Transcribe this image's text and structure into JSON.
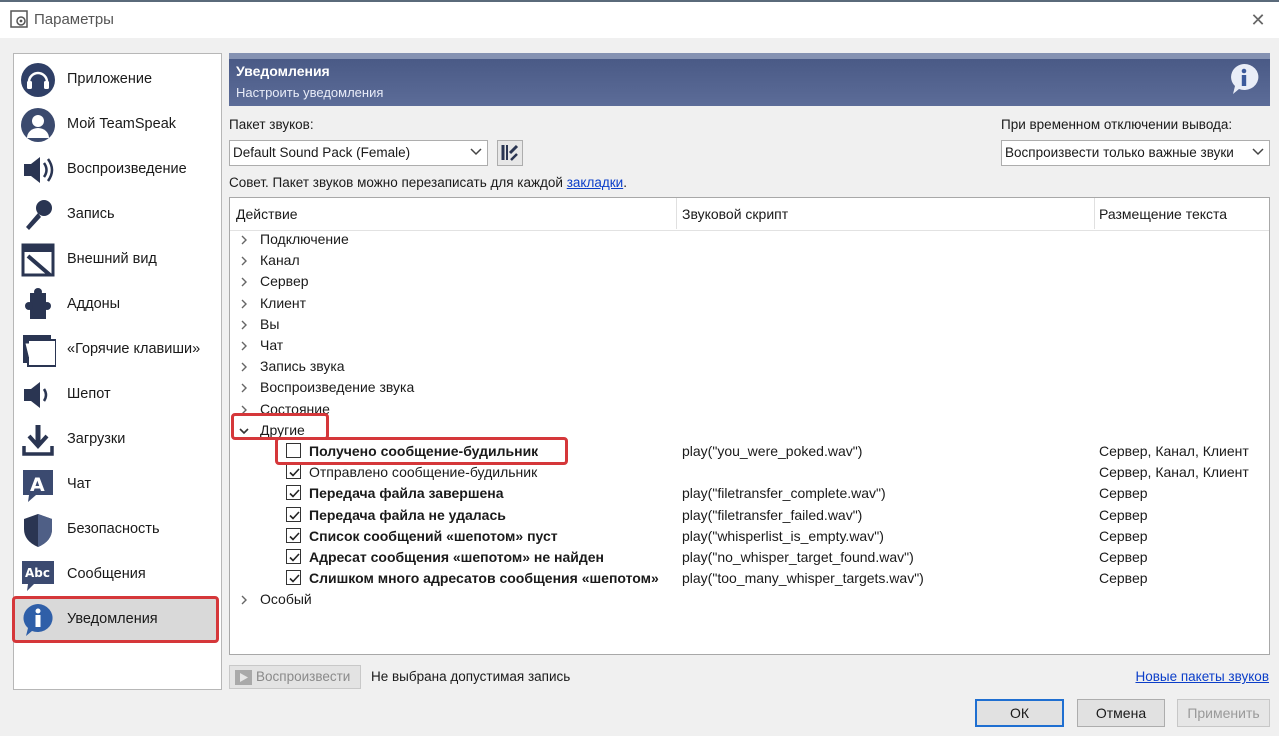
{
  "window": {
    "title": "Параметры",
    "close_icon": "close-icon"
  },
  "sidebar": {
    "items": [
      {
        "label": "Приложение",
        "icon": "headset-icon"
      },
      {
        "label": "Мой TeamSpeak",
        "icon": "user-profile-icon"
      },
      {
        "label": "Воспроизведение",
        "icon": "speaker-icon"
      },
      {
        "label": "Запись",
        "icon": "microphone-icon"
      },
      {
        "label": "Внешний вид",
        "icon": "appearance-icon"
      },
      {
        "label": "Аддоны",
        "icon": "puzzle-icon"
      },
      {
        "label": "«Горячие клавиши»",
        "icon": "hotkeys-icon"
      },
      {
        "label": "Шепот",
        "icon": "whisper-icon"
      },
      {
        "label": "Загрузки",
        "icon": "download-icon"
      },
      {
        "label": "Чат",
        "icon": "chat-icon"
      },
      {
        "label": "Безопасность",
        "icon": "shield-icon"
      },
      {
        "label": "Сообщения",
        "icon": "messages-icon"
      },
      {
        "label": "Уведомления",
        "icon": "info-icon",
        "active": true
      }
    ]
  },
  "banner": {
    "title": "Уведомления",
    "subtitle": "Настроить уведомления"
  },
  "soundpack": {
    "label": "Пакет звуков:",
    "value": "Default Sound Pack (Female)"
  },
  "mute_output": {
    "label": "При временном отключении вывода:",
    "value": "Воспроизвести только важные звуки"
  },
  "hint": {
    "text": "Совет. Пакет звуков можно перезаписать для каждой ",
    "link": "закладки",
    "tail": "."
  },
  "table": {
    "columns": [
      "Действие",
      "Звуковой скрипт",
      "Размещение текста"
    ],
    "groups": [
      "Подключение",
      "Канал",
      "Сервер",
      "Клиент",
      "Вы",
      "Чат",
      "Запись звука",
      "Воспроизведение звука",
      "Состояние"
    ],
    "open_group": "Другие",
    "children": [
      {
        "name": "Получено сообщение-будильник",
        "bold": true,
        "checked": false,
        "script": "play(\"you_were_poked.wav\")",
        "place": "Сервер, Канал, Клиент"
      },
      {
        "name": "Отправлено сообщение-будильник",
        "bold": false,
        "checked": true,
        "script": "",
        "place": "Сервер, Канал, Клиент"
      },
      {
        "name": "Передача файла завершена",
        "bold": true,
        "checked": true,
        "script": "play(\"filetransfer_complete.wav\")",
        "place": "Сервер"
      },
      {
        "name": "Передача файла не удалась",
        "bold": true,
        "checked": true,
        "script": "play(\"filetransfer_failed.wav\")",
        "place": "Сервер"
      },
      {
        "name": "Список сообщений «шепотом» пуст",
        "bold": true,
        "checked": true,
        "script": "play(\"whisperlist_is_empty.wav\")",
        "place": "Сервер"
      },
      {
        "name": "Адресат сообщения «шепотом» не найден",
        "bold": true,
        "checked": true,
        "script": "play(\"no_whisper_target_found.wav\")",
        "place": "Сервер"
      },
      {
        "name": "Слишком много адресатов сообщения «шепотом»",
        "bold": true,
        "checked": true,
        "script": "play(\"too_many_whisper_targets.wav\")",
        "place": "Сервер"
      }
    ],
    "last_group": "Особый"
  },
  "bottom": {
    "play_label": "Воспроизвести",
    "status": "Не выбрана допустимая запись",
    "new_packs_link": "Новые пакеты звуков"
  },
  "buttons": {
    "ok": "ОК",
    "cancel": "Отмена",
    "apply": "Применить"
  }
}
